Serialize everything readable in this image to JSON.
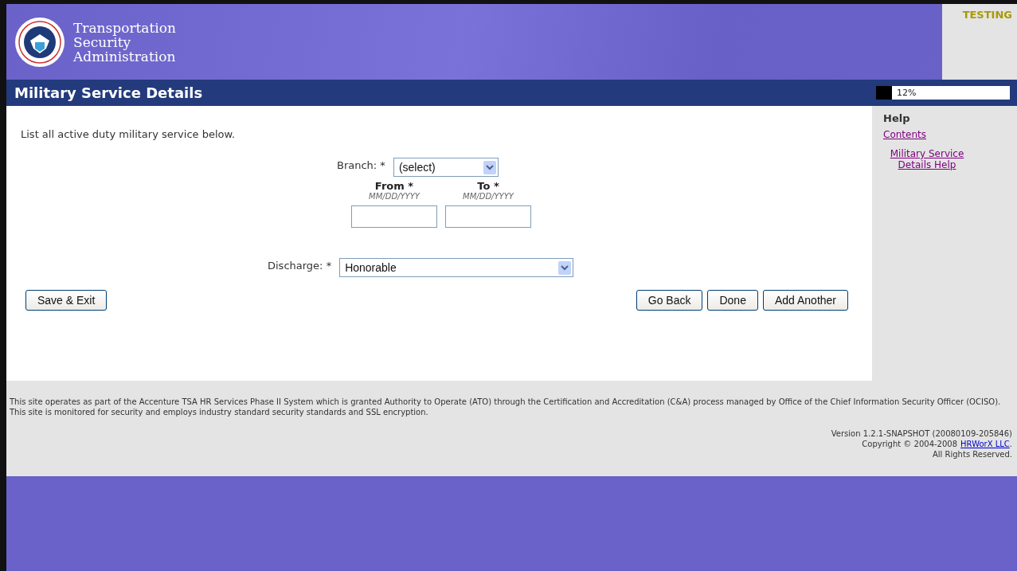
{
  "header": {
    "agency": [
      "Transportation",
      "Security",
      "Administration"
    ],
    "environment": "TESTING"
  },
  "title_bar": {
    "title": "Military Service Details",
    "progress": {
      "level": 0.12,
      "reading": "12%"
    }
  },
  "form": {
    "intro": "List all active duty military service below.",
    "branch": {
      "label": "Branch: *",
      "value": "(select)"
    },
    "dates": [
      {
        "label": "From *",
        "hint": "MM/DD/YYYY"
      },
      {
        "label": "To *",
        "hint": "MM/DD/YYYY"
      }
    ],
    "discharge": {
      "label": "Discharge: *",
      "value": "Honorable"
    },
    "left_buttons": [
      "Save & Exit"
    ],
    "right_buttons": [
      "Go Back",
      "Done",
      "Add Another"
    ]
  },
  "help": {
    "title": "Help",
    "links": [
      "Contents",
      "Military Service Details Help"
    ]
  },
  "footer": {
    "notice": "This site operates as part of the Accenture TSA HR Services Phase II System which is granted Authority to Operate (ATO) through the Certification and Accreditation (C&A) process managed by Office of the Chief Information Security Officer (OCISO). This site is monitored for security and employs industry standard security standards and SSL encryption.",
    "version": "Version 1.2.1-SNAPSHOT (20080109-205846)",
    "copyright": {
      "prefix": "Copyright © 2004-2008",
      "link": "HRWorX LLC",
      "suffix": "."
    },
    "rights": "All Rights Reserved."
  }
}
